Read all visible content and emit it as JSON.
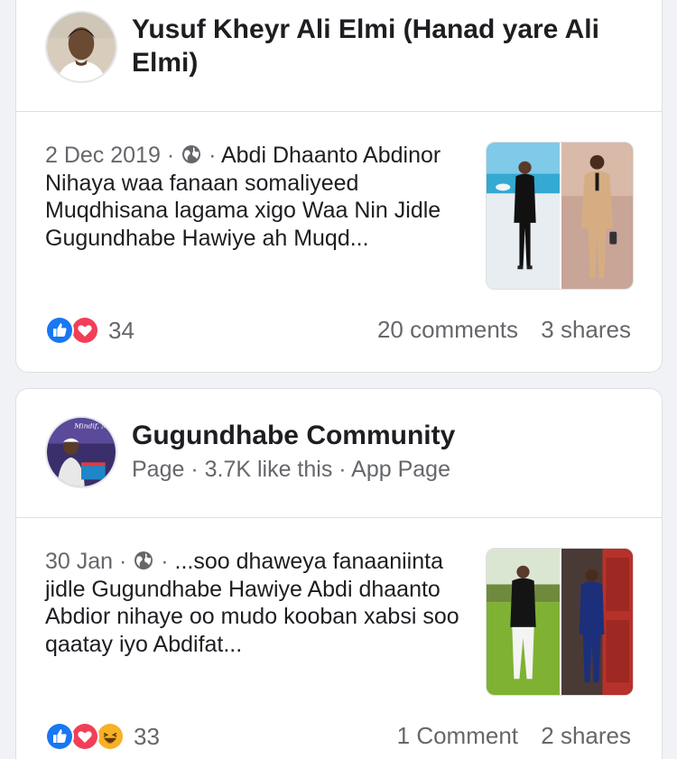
{
  "posts": [
    {
      "author": "Yusuf Kheyr Ali Elmi (Hanad yare Ali Elmi)",
      "subtitle": "",
      "date": "2 Dec 2019",
      "separator": "·",
      "snippet": "Abdi Dhaanto Abdinor Nihaya  waa fanaan somaliyeed Muqdhisana lagama xigo Waa Nin Jidle  Gugundhabe  Hawiye ah Muqd...",
      "reaction_count": "34",
      "reactions": [
        "like-reaction",
        "love-reaction"
      ],
      "comments": "20 comments",
      "shares": "3 shares"
    },
    {
      "author": "Gugundhabe Community",
      "subtitle": "Page · 3.7K like this · App Page",
      "avatar_banner": "Mindif, Midnight\nuntashi\nAkhor",
      "date": "30 Jan",
      "separator": "·",
      "snippet": "...soo dhaweya fanaaniinta jidle Gugundhabe Hawiye Abdi dhaanto Abdior nihaye oo mudo kooban xabsi soo qaatay iyo Abdifat...",
      "reaction_count": "33",
      "reactions": [
        "like-reaction",
        "love-reaction",
        "haha-reaction"
      ],
      "comments": "1 Comment",
      "shares": "2 shares"
    }
  ],
  "colors": {
    "page_bg": "#f0f2f5",
    "like_blue": "#1877f2",
    "love_red": "#f33e58",
    "haha_yellow": "#f7b125",
    "meta_gray": "#65676b"
  },
  "icons": {
    "privacy": "globe-icon"
  }
}
